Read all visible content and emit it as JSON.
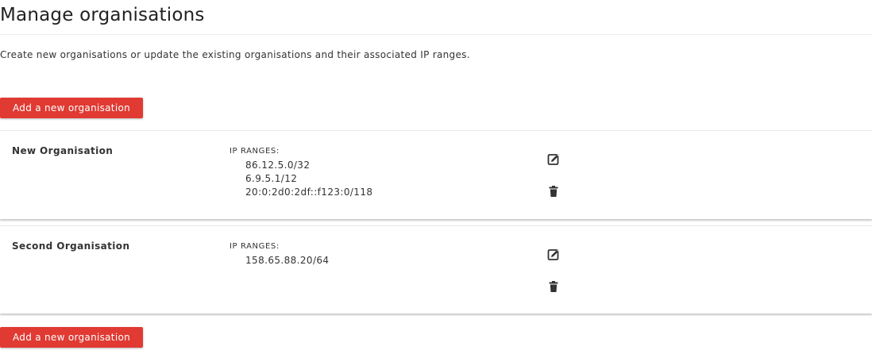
{
  "page": {
    "title": "Manage organisations",
    "description": "Create new organisations or update the existing organisations and their associated IP ranges."
  },
  "actions": {
    "add_label": "Add a new organisation"
  },
  "organisations": [
    {
      "name": "New Organisation",
      "ip_label": "IP RANGES:",
      "ip_ranges": [
        "86.12.5.0/32",
        "6.9.5.1/12",
        "20:0:2d0:2df::f123:0/118"
      ],
      "edit_icon": "edit-icon",
      "delete_icon": "trash-icon"
    },
    {
      "name": "Second Organisation",
      "ip_label": "IP RANGES:",
      "ip_ranges": [
        "158.65.88.20/64"
      ],
      "edit_icon": "edit-icon",
      "delete_icon": "trash-icon"
    }
  ],
  "colors": {
    "primary_button": "#e03a33",
    "icon": "#333333"
  }
}
